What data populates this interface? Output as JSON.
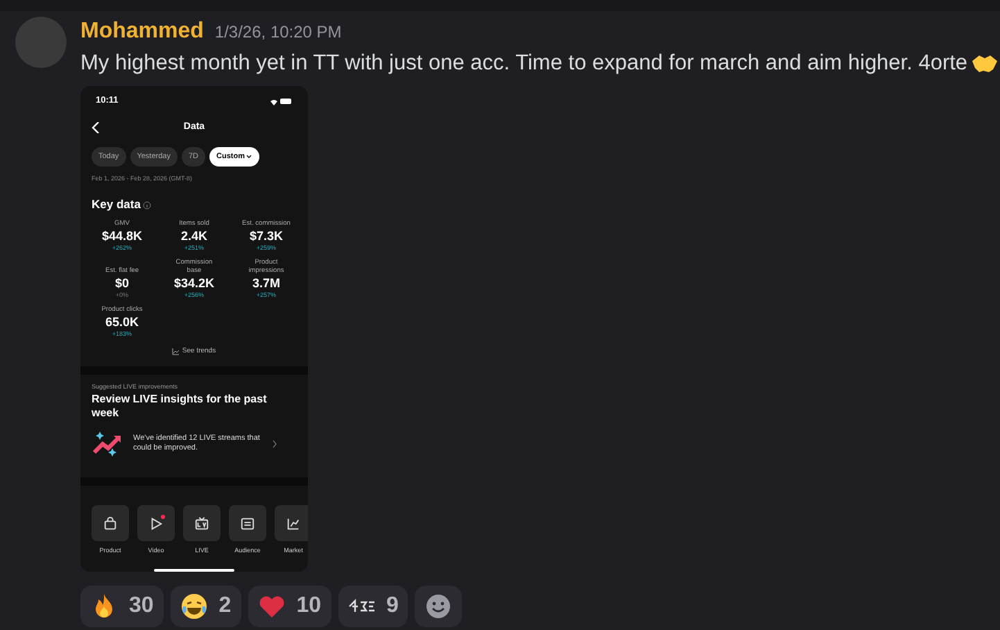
{
  "message": {
    "author": "Mohammed",
    "timestamp": "1/3/26, 10:20 PM",
    "text": "My highest month yet in TT with just one acc. Time to expand for march and aim higher. 4orte"
  },
  "phone": {
    "status_time": "10:11",
    "title": "Data",
    "filters": [
      {
        "label": "Today",
        "selected": false
      },
      {
        "label": "Yesterday",
        "selected": false
      },
      {
        "label": "7D",
        "selected": false
      },
      {
        "label": "Custom",
        "selected": true
      }
    ],
    "date_range": "Feb 1, 2026 - Feb 28, 2026 (GMT-8)",
    "section_title": "Key data",
    "metrics": [
      {
        "label": "GMV",
        "value": "$44.8K",
        "change": "+262%",
        "kind": "up"
      },
      {
        "label": "Items sold",
        "value": "2.4K",
        "change": "+251%",
        "kind": "up"
      },
      {
        "label": "Est. commission",
        "value": "$7.3K",
        "change": "+259%",
        "kind": "up"
      },
      {
        "label": "Est. flat fee",
        "value": "$0",
        "change": "+0%",
        "kind": "flat"
      },
      {
        "label": "Commission base",
        "value": "$34.2K",
        "change": "+256%",
        "kind": "up"
      },
      {
        "label": "Product impressions",
        "value": "3.7M",
        "change": "+257%",
        "kind": "up"
      },
      {
        "label": "Product clicks",
        "value": "65.0K",
        "change": "+183%",
        "kind": "up"
      }
    ],
    "see_trends": "See trends",
    "suggestion": {
      "eyebrow": "Suggested LIVE improvements",
      "title": "Review LIVE insights for the past week",
      "body": "We've identified 12 LIVE streams that could be improved."
    },
    "tools": [
      {
        "label": "Product",
        "kind": "bag",
        "badge": false
      },
      {
        "label": "Video",
        "kind": "play",
        "badge": true
      },
      {
        "label": "LIVE",
        "kind": "live",
        "badge": false
      },
      {
        "label": "Audience",
        "kind": "card",
        "badge": false
      },
      {
        "label": "Market",
        "kind": "chart",
        "badge": false
      }
    ]
  },
  "reactions": [
    {
      "kind": "fire",
      "count": "30"
    },
    {
      "kind": "laugh",
      "count": "2"
    },
    {
      "kind": "heart",
      "count": "10"
    },
    {
      "kind": "custom",
      "count": "9"
    }
  ]
}
